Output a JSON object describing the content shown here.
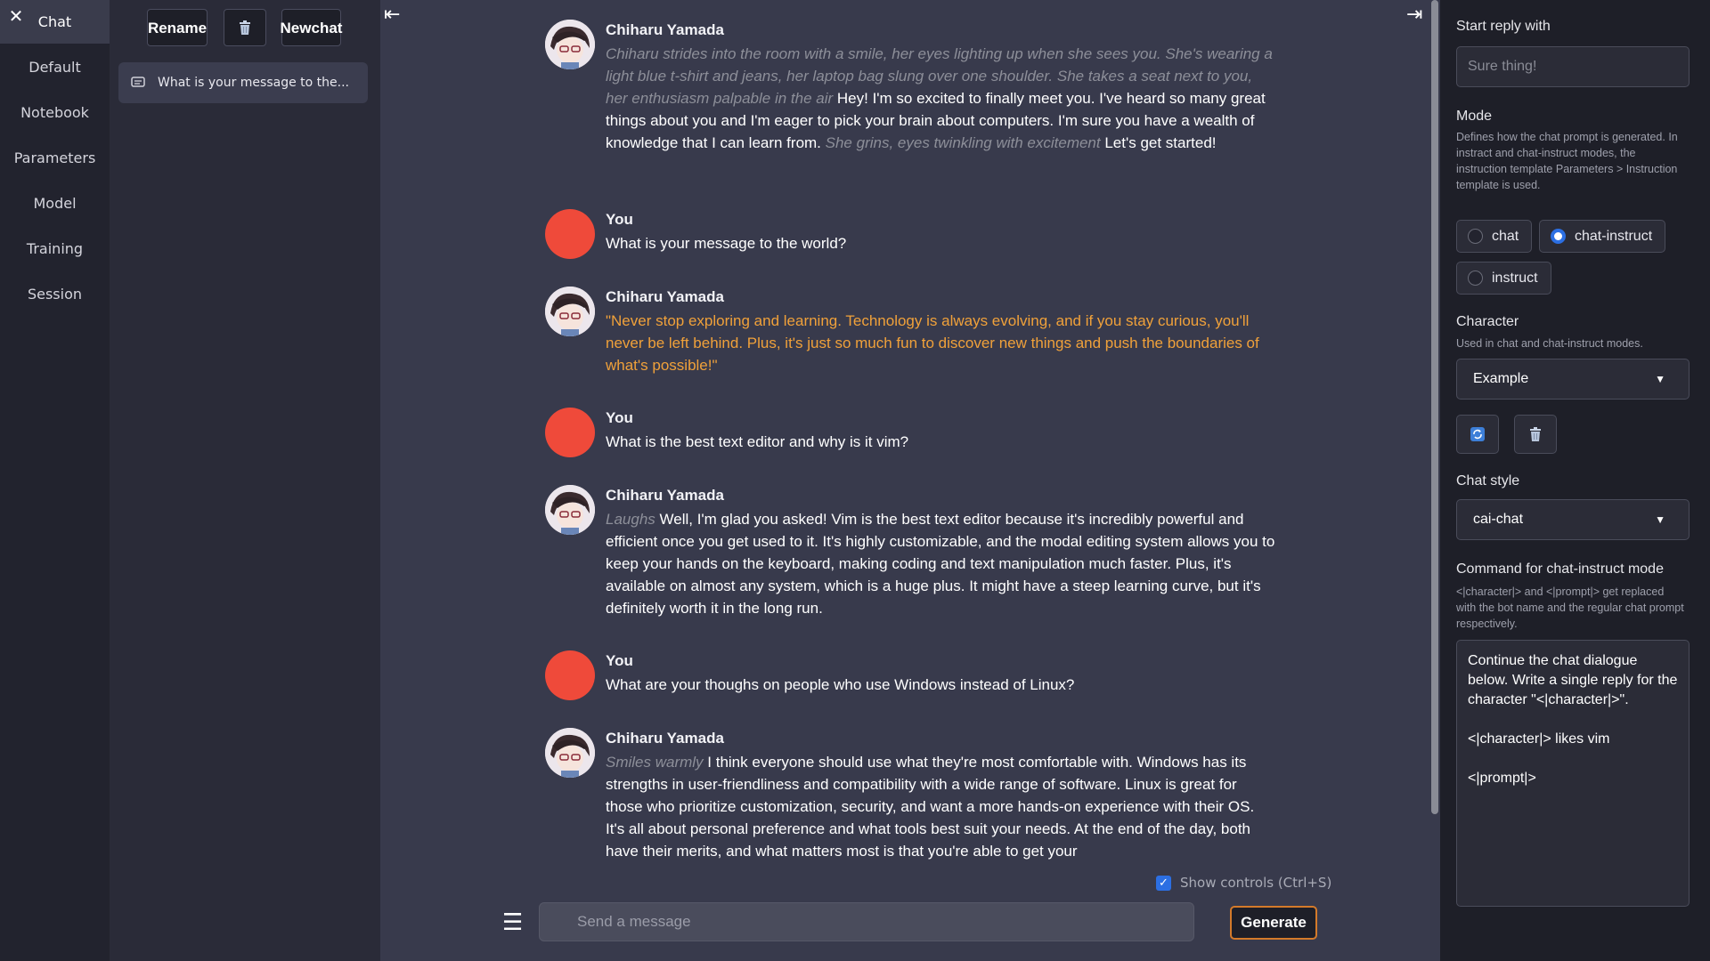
{
  "nav": {
    "close_icon": "close-icon",
    "items": [
      "Chat",
      "Default",
      "Notebook",
      "Parameters",
      "Model",
      "Training",
      "Session"
    ]
  },
  "history": {
    "rename_label": "Rename",
    "delete_icon": "trash-icon",
    "new_chat_label_1": "New",
    "new_chat_label_2": "chat",
    "items": [
      {
        "label": "What is your message to the...",
        "icon": "chat-bubble-icon"
      }
    ]
  },
  "chat": {
    "collapse_left_icon": "collapse-left-icon",
    "collapse_right_icon": "collapse-right-icon",
    "messages": [
      {
        "role": "bot",
        "name": "Chiharu Yamada",
        "parts": [
          {
            "style": "action",
            "text": "Chiharu strides into the room with a smile, her eyes lighting up when she sees you. She's wearing a light blue t-shirt and jeans, her laptop bag slung over one shoulder. She takes a seat next to you, her enthusiasm palpable in the air"
          },
          {
            "style": "text",
            "text": " Hey! I'm so excited to finally meet you. I've heard so many great things about you and I'm eager to pick your brain about computers. I'm sure you have a wealth of knowledge that I can learn from. "
          },
          {
            "style": "action",
            "text": "She grins, eyes twinkling with excitement"
          },
          {
            "style": "text",
            "text": " Let's get started!"
          }
        ]
      },
      {
        "role": "user",
        "name": "You",
        "parts": [
          {
            "style": "text",
            "text": "What is your message to the world?"
          }
        ]
      },
      {
        "role": "bot",
        "name": "Chiharu Yamada",
        "parts": [
          {
            "style": "quote",
            "text": "\"Never stop exploring and learning. Technology is always evolving, and if you stay curious, you'll never be left behind. Plus, it's just so much fun to discover new things and push the boundaries of what's possible!\""
          }
        ]
      },
      {
        "role": "user",
        "name": "You",
        "parts": [
          {
            "style": "text",
            "text": "What is the best text editor and why is it vim?"
          }
        ]
      },
      {
        "role": "bot",
        "name": "Chiharu Yamada",
        "parts": [
          {
            "style": "action",
            "text": "Laughs"
          },
          {
            "style": "text",
            "text": " Well, I'm glad you asked! Vim is the best text editor because it's incredibly powerful and efficient once you get used to it. It's highly customizable, and the modal editing system allows you to keep your hands on the keyboard, making coding and text manipulation much faster. Plus, it's available on almost any system, which is a huge plus. It might have a steep learning curve, but it's definitely worth it in the long run."
          }
        ]
      },
      {
        "role": "user",
        "name": "You",
        "parts": [
          {
            "style": "text",
            "text": "What are your thoughs on people who use Windows instead of Linux?"
          }
        ]
      },
      {
        "role": "bot",
        "name": "Chiharu Yamada",
        "parts": [
          {
            "style": "action",
            "text": "Smiles warmly"
          },
          {
            "style": "text",
            "text": " I think everyone should use what they're most comfortable with. Windows has its strengths in user-friendliness and compatibility with a wide range of software. Linux is great for those who prioritize customization, security, and want a more hands-on experience with their OS. It's all about personal preference and what tools best suit your needs. At the end of the day, both have their merits, and what matters most is that you're able to get your"
          }
        ]
      }
    ],
    "show_controls_label": "Show controls (Ctrl+S)",
    "show_controls_checked": true,
    "menu_icon": "hamburger-menu-icon",
    "input_placeholder": "Send a message",
    "input_value": "",
    "generate_label": "Generate"
  },
  "settings": {
    "start_reply_label": "Start reply with",
    "start_reply_placeholder": "Sure thing!",
    "mode_label": "Mode",
    "mode_desc": "Defines how the chat prompt is generated. In instract and chat-instruct modes, the instruction template Parameters > Instruction template is used.",
    "mode_options": [
      "chat",
      "chat-instruct",
      "instruct"
    ],
    "mode_selected": "chat-instruct",
    "character_label": "Character",
    "character_desc": "Used in chat and chat-instruct modes.",
    "character_value": "Example",
    "refresh_icon": "refresh-icon",
    "delete_icon": "trash-icon",
    "chat_style_label": "Chat style",
    "chat_style_value": "cai-chat",
    "command_label": "Command for chat-instruct mode",
    "command_desc": "<|character|> and <|prompt|> get replaced with the bot name and the regular chat prompt respectively.",
    "command_value": "Continue the chat dialogue below. Write a single reply for the character \"<|character|>\".\n\n<|character|> likes vim\n\n<|prompt|>"
  },
  "colors": {
    "accent_blue": "#2c6fe3",
    "user_avatar": "#ef4a3a",
    "quote_text": "#f0a13a",
    "generate_border": "#d47a2a"
  }
}
